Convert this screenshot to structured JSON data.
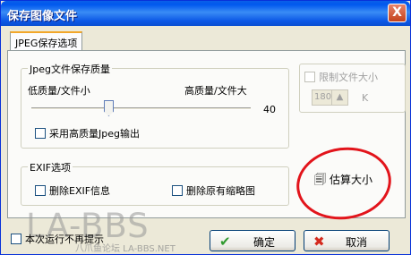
{
  "window": {
    "title": "保存图像文件",
    "close_label": "X"
  },
  "tab": {
    "label": "JPEG保存选项"
  },
  "quality_group": {
    "title": "Jpeg文件保存质量",
    "low_label": "低质量/文件小",
    "high_label": "高质量/文件大",
    "value": "40",
    "slider_position": 0.4,
    "high_quality_label": "采用高质量Jpeg输出"
  },
  "exif_group": {
    "title": "EXIF选项",
    "delete_exif_label": "删除EXIF信息",
    "delete_thumb_label": "删除原有缩略图"
  },
  "limit": {
    "label": "限制文件大小",
    "value": "180",
    "unit": "K"
  },
  "estimate_label": "估算大小",
  "footer": {
    "dont_show_label": "本次运行不再提示",
    "ok_label": "确定",
    "cancel_label": "取消"
  },
  "watermark": {
    "main": "LA-BBS",
    "sub": "八爪鱼论坛 LA-BBS.NET"
  },
  "colors": {
    "title_bar": "#0058ee",
    "annotation_circle": "#e2141b"
  }
}
